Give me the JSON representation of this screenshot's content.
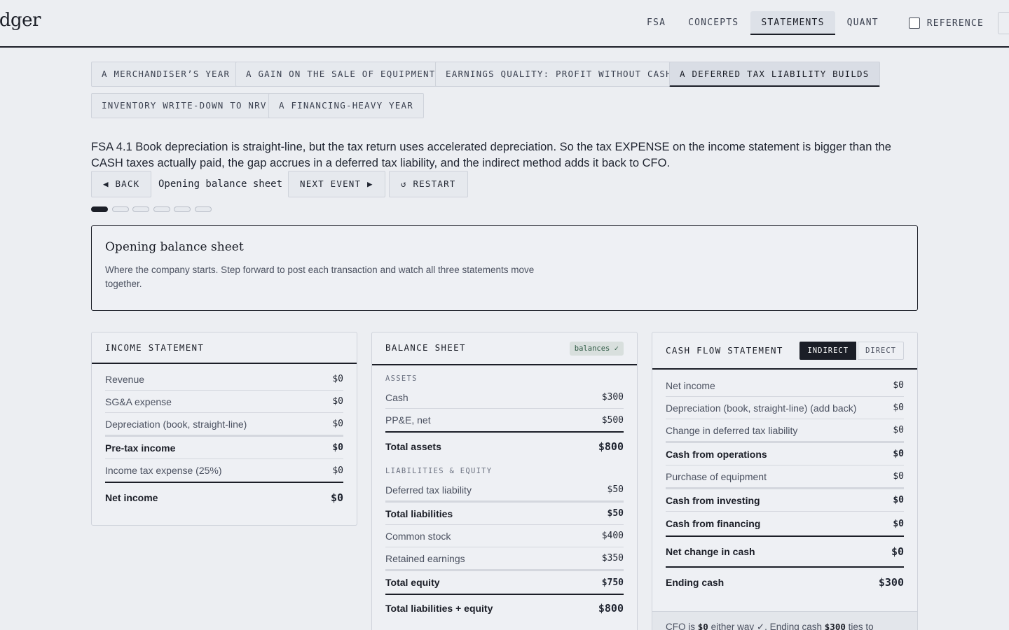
{
  "app": {
    "logo": "edger"
  },
  "nav": {
    "tabs": [
      "FSA",
      "CONCEPTS",
      "STATEMENTS",
      "QUANT"
    ],
    "active": "STATEMENTS",
    "reference_label": "REFERENCE"
  },
  "scenarios": [
    "A MERCHANDISER’S YEAR",
    "A GAIN ON THE SALE OF EQUIPMENT",
    "EARNINGS QUALITY: PROFIT WITHOUT CASH",
    "A DEFERRED TAX LIABILITY BUILDS",
    "INVENTORY WRITE-DOWN TO NRV",
    "A FINANCING-HEAVY YEAR"
  ],
  "active_scenario": "A DEFERRED TAX LIABILITY BUILDS",
  "intro": "FSA 4.1 Book depreciation is straight-line, but the tax return uses accelerated depreciation. So the tax EXPENSE on the income statement is bigger than the CASH taxes actually paid, the gap accrues in a deferred tax liability, and the indirect method adds it back to CFO.",
  "controls": {
    "back": "◀ BACK",
    "step_label": "Opening balance sheet",
    "next": "NEXT EVENT ▶",
    "restart": "↺ RESTART"
  },
  "progress": {
    "steps": 6,
    "current": 1
  },
  "event": {
    "title": "Opening balance sheet",
    "description": "Where the company starts. Step forward to post each transaction and watch all three statements move together."
  },
  "income_statement": {
    "title": "INCOME STATEMENT",
    "revenue": {
      "label": "Revenue",
      "value": "$0"
    },
    "sga": {
      "label": "SG&A expense",
      "value": "$0"
    },
    "depreciation": {
      "label": "Depreciation (book, straight-line)",
      "value": "$0"
    },
    "pretax": {
      "label": "Pre-tax income",
      "value": "$0"
    },
    "tax": {
      "label": "Income tax expense (25%)",
      "value": "$0"
    },
    "net_income": {
      "label": "Net income",
      "value": "$0"
    }
  },
  "balance_sheet": {
    "title": "BALANCE SHEET",
    "badge": "balances ✓",
    "assets_label": "ASSETS",
    "cash": {
      "label": "Cash",
      "value": "$300"
    },
    "ppe": {
      "label": "PP&E, net",
      "value": "$500"
    },
    "total_assets": {
      "label": "Total assets",
      "value": "$800"
    },
    "le_label": "LIABILITIES & EQUITY",
    "dtl": {
      "label": "Deferred tax liability",
      "value": "$50"
    },
    "total_liabilities": {
      "label": "Total liabilities",
      "value": "$50"
    },
    "common_stock": {
      "label": "Common stock",
      "value": "$400"
    },
    "retained_earnings": {
      "label": "Retained earnings",
      "value": "$350"
    },
    "total_equity": {
      "label": "Total equity",
      "value": "$750"
    },
    "total_le": {
      "label": "Total liabilities + equity",
      "value": "$800"
    }
  },
  "cash_flow": {
    "title": "CASH FLOW STATEMENT",
    "mode_indirect": "INDIRECT",
    "mode_direct": "DIRECT",
    "active_mode": "INDIRECT",
    "net_income": {
      "label": "Net income",
      "value": "$0"
    },
    "depreciation": {
      "label": "Depreciation (book, straight-line) (add back)",
      "value": "$0"
    },
    "dtl_change": {
      "label": "Change in deferred tax liability",
      "value": "$0"
    },
    "cfo": {
      "label": "Cash from operations",
      "value": "$0"
    },
    "equipment": {
      "label": "Purchase of equipment",
      "value": "$0"
    },
    "cfi": {
      "label": "Cash from investing",
      "value": "$0"
    },
    "cff": {
      "label": "Cash from financing",
      "value": "$0"
    },
    "net_change": {
      "label": "Net change in cash",
      "value": "$0"
    },
    "ending_cash": {
      "label": "Ending cash",
      "value": "$300"
    },
    "note_prefix": "CFO is",
    "note_cfo": "$0",
    "note_mid": "either way ✓. Ending cash",
    "note_cash": "$300",
    "note_suffix": "ties to"
  }
}
